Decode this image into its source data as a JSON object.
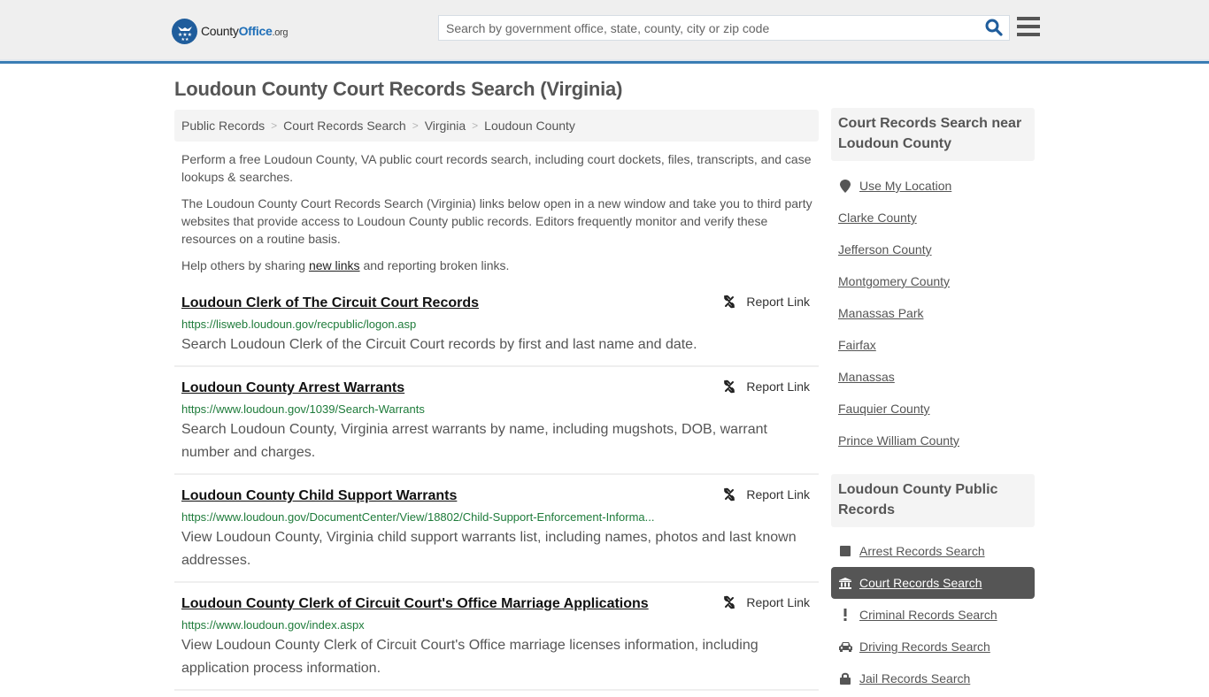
{
  "header": {
    "logo": {
      "brand_part1": "County",
      "brand_part2": "Office",
      "brand_suffix": ".org"
    },
    "search": {
      "placeholder": "Search by government office, state, county, city or zip code",
      "value": ""
    },
    "icons": {
      "search": "search-icon",
      "menu": "hamburger-menu-icon"
    }
  },
  "page": {
    "title": "Loudoun County Court Records Search (Virginia)"
  },
  "breadcrumb": [
    {
      "label": "Public Records"
    },
    {
      "label": "Court Records Search"
    },
    {
      "label": "Virginia"
    },
    {
      "label": "Loudoun County"
    }
  ],
  "intro": {
    "p1": "Perform a free Loudoun County, VA public court records search, including court dockets, files, transcripts, and case lookups & searches.",
    "p2": "The Loudoun County Court Records Search (Virginia) links below open in a new window and take you to third party websites that provide access to Loudoun County public records. Editors frequently monitor and verify these resources on a routine basis.",
    "p3_before": "Help others by sharing ",
    "p3_link": "new links",
    "p3_after": " and reporting broken links."
  },
  "results": [
    {
      "title": "Loudoun Clerk of The Circuit Court Records",
      "url": "https://lisweb.loudoun.gov/recpublic/logon.asp",
      "description": "Search Loudoun Clerk of the Circuit Court records by first and last name and date.",
      "report_label": "Report Link"
    },
    {
      "title": "Loudoun County Arrest Warrants",
      "url": "https://www.loudoun.gov/1039/Search-Warrants",
      "description": "Search Loudoun County, Virginia arrest warrants by name, including mugshots, DOB, warrant number and charges.",
      "report_label": "Report Link"
    },
    {
      "title": "Loudoun County Child Support Warrants",
      "url": "https://www.loudoun.gov/DocumentCenter/View/18802/Child-Support-Enforcement-Informa...",
      "description": "View Loudoun County, Virginia child support warrants list, including names, photos and last known addresses.",
      "report_label": "Report Link"
    },
    {
      "title": "Loudoun County Clerk of Circuit Court's Office Marriage Applications",
      "url": "https://www.loudoun.gov/index.aspx",
      "description": "View Loudoun County Clerk of Circuit Court's Office marriage licenses information, including application process information.",
      "report_label": "Report Link"
    }
  ],
  "sidebar": {
    "nearby": {
      "heading": "Court Records Search near Loudoun County",
      "use_location": "Use My Location",
      "items": [
        {
          "label": "Clarke County"
        },
        {
          "label": "Jefferson County"
        },
        {
          "label": "Montgomery County"
        },
        {
          "label": "Manassas Park"
        },
        {
          "label": "Fairfax"
        },
        {
          "label": "Manassas"
        },
        {
          "label": "Fauquier County"
        },
        {
          "label": "Prince William County"
        }
      ]
    },
    "public_records": {
      "heading": "Loudoun County Public Records",
      "items": [
        {
          "label": "Arrest Records Search",
          "icon": "square-icon",
          "active": false
        },
        {
          "label": "Court Records Search",
          "icon": "courthouse-icon",
          "active": true
        },
        {
          "label": "Criminal Records Search",
          "icon": "exclamation-icon",
          "active": false
        },
        {
          "label": "Driving Records Search",
          "icon": "car-icon",
          "active": false
        },
        {
          "label": "Jail Records Search",
          "icon": "lock-icon",
          "active": false
        }
      ]
    }
  },
  "colors": {
    "accent": "#3a7db4",
    "brand_blue": "#1f6fb8",
    "url_green": "#1e7b3a",
    "active_bg": "#555555"
  }
}
